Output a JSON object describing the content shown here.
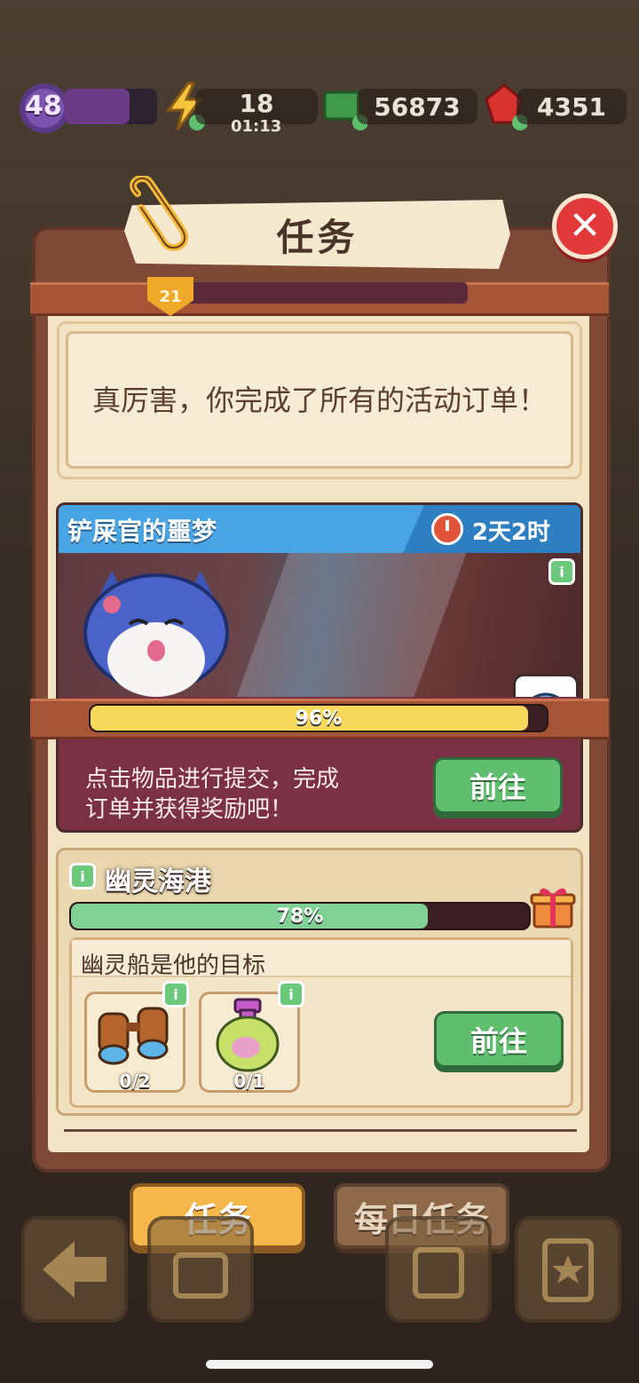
{
  "hud": {
    "level": "48",
    "level_progress": 0.7,
    "energy": "18",
    "energy_timer": "01:13",
    "cash": "56873",
    "gems": "4351"
  },
  "panel": {
    "title": "任务",
    "tier_badge": "21",
    "all_done_message": "真厉害，你完成了所有的活动订单！"
  },
  "event": {
    "title": "铲屎官的噩梦",
    "time_left": "2天2时",
    "progress_value": 0.96,
    "progress_label": "96%",
    "description_line1": "点击物品进行提交，完成",
    "description_line2": "订单并获得奖励吧！",
    "go_label": "前往"
  },
  "harbor": {
    "title": "幽灵海港",
    "progress_value": 0.78,
    "progress_label": "78%",
    "quest_title": "幽灵船是他的目标",
    "items": [
      {
        "icon": "binoculars-icon",
        "count": "0/2"
      },
      {
        "icon": "potion-bottle-icon",
        "count": "0/1"
      }
    ],
    "go_label": "前往"
  },
  "tabs": {
    "tasks": "任务",
    "daily": "每日任务"
  },
  "colors": {
    "accent_orange": "#f5b64a",
    "go_green": "#5fbf6f",
    "event_blue": "#49a4e3",
    "progress_yellow": "#f7d85a",
    "progress_green": "#7fd293"
  }
}
